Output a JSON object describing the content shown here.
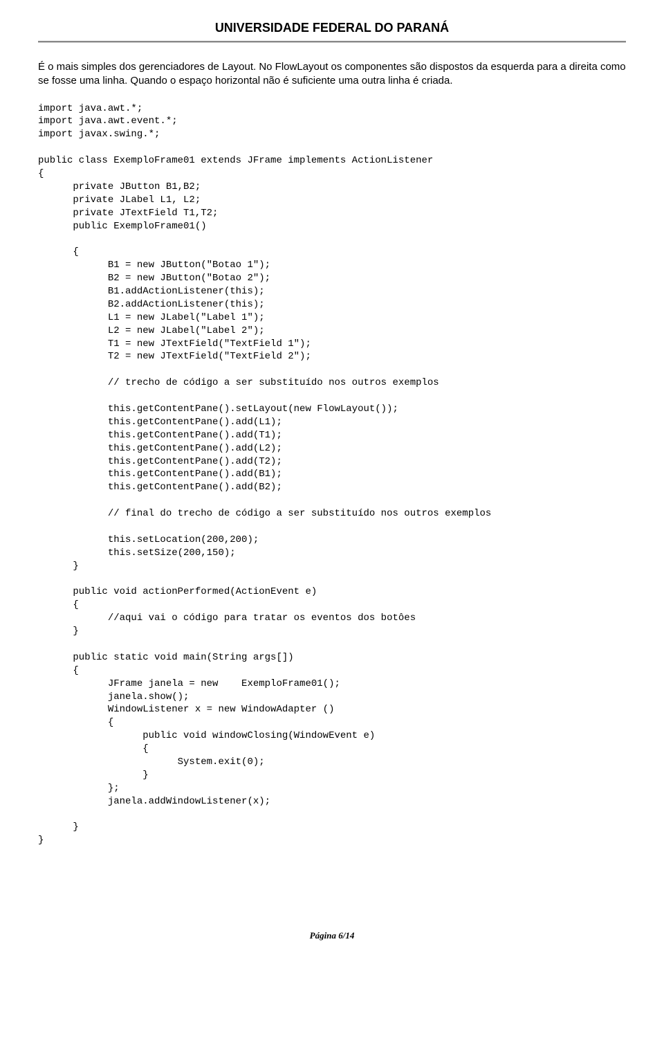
{
  "header": {
    "title": "UNIVERSIDADE FEDERAL DO PARANÁ"
  },
  "intro": "É o mais simples dos gerenciadores de Layout. No FlowLayout os componentes são dispostos da esquerda para a direita como se fosse uma linha. Quando o espaço horizontal não é suficiente uma outra linha é criada.",
  "code": "import java.awt.*;\nimport java.awt.event.*;\nimport javax.swing.*;\n\npublic class ExemploFrame01 extends JFrame implements ActionListener\n{\n      private JButton B1,B2;\n      private JLabel L1, L2;\n      private JTextField T1,T2;\n      public ExemploFrame01()\n\n      {\n            B1 = new JButton(\"Botao 1\");\n            B2 = new JButton(\"Botao 2\");\n            B1.addActionListener(this);\n            B2.addActionListener(this);\n            L1 = new JLabel(\"Label 1\");\n            L2 = new JLabel(\"Label 2\");\n            T1 = new JTextField(\"TextField 1\");\n            T2 = new JTextField(\"TextField 2\");\n\n            // trecho de código a ser substituído nos outros exemplos\n\n            this.getContentPane().setLayout(new FlowLayout());\n            this.getContentPane().add(L1);\n            this.getContentPane().add(T1);\n            this.getContentPane().add(L2);\n            this.getContentPane().add(T2);\n            this.getContentPane().add(B1);\n            this.getContentPane().add(B2);\n\n            // final do trecho de código a ser substituído nos outros exemplos\n\n            this.setLocation(200,200);\n            this.setSize(200,150);\n      }\n\n      public void actionPerformed(ActionEvent e)\n      {\n            //aqui vai o código para tratar os eventos dos botôes\n      }\n\n      public static void main(String args[])\n      {\n            JFrame janela = new    ExemploFrame01();\n            janela.show();\n            WindowListener x = new WindowAdapter ()\n            {\n                  public void windowClosing(WindowEvent e)\n                  {\n                        System.exit(0);\n                  }\n            };\n            janela.addWindowListener(x);\n\n      }\n}",
  "footer": "Página 6/14"
}
